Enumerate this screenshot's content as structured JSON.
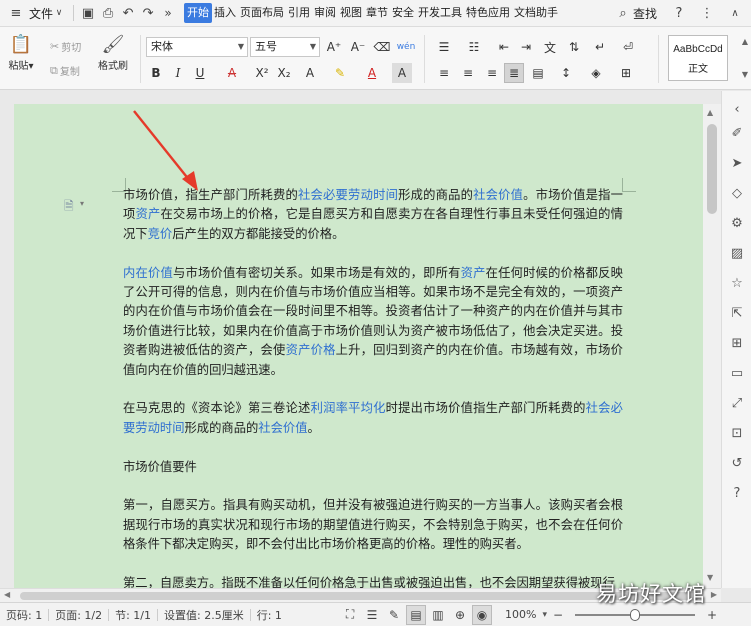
{
  "menubar": {
    "file_label": "文件",
    "tabs": [
      "开始",
      "插入",
      "页面布局",
      "引用",
      "审阅",
      "视图",
      "章节",
      "安全",
      "开发工具",
      "特色应用",
      "文档助手"
    ],
    "active_tab": "开始",
    "search_label": "查找"
  },
  "ribbon": {
    "paste_label": "粘贴",
    "cut_label": "剪切",
    "copy_label": "复制",
    "format_painter_label": "格式刷",
    "font_name": "宋体",
    "font_size": "五号",
    "style_preview": "AaBbCcDd",
    "style_name": "正文"
  },
  "document": {
    "paragraphs": [
      [
        {
          "t": "市场价值，指生产部门所耗费的"
        },
        {
          "t": "社会必要劳动时间",
          "link": true
        },
        {
          "t": "形成的商品的"
        },
        {
          "t": "社会价值",
          "link": true
        },
        {
          "t": "。市场价值是指一项"
        },
        {
          "t": "资产",
          "link": true
        },
        {
          "t": "在交易市场上的价格，它是自愿买方和自愿卖方在各自理性行事且未受任何强迫的情况下"
        },
        {
          "t": "竞价",
          "link": true
        },
        {
          "t": "后产生的双方都能接受的价格。"
        }
      ],
      [
        {
          "t": "内在价值",
          "link": true
        },
        {
          "t": "与市场价值有密切关系。如果市场是有效的，即所有"
        },
        {
          "t": "资产",
          "link": true
        },
        {
          "t": "在任何时候的价格都反映了公开可得的信息，则内在价值与市场价值应当相等。如果市场不是完全有效的，一项资产的内在价值与市场价值会在一段时间里不相等。投资者估计了一种资产的内在价值并与其市场价值进行比较，如果内在价值高于市场价值则认为资产被市场低估了，他会决定买进。投资者购进被低估的资产，会使"
        },
        {
          "t": "资产价格",
          "link": true
        },
        {
          "t": "上升，回归到资产的内在价值。市场越有效，市场价值向内在价值的回归越迅速。"
        }
      ],
      [
        {
          "t": "在马克思的《资本论》第三卷论述"
        },
        {
          "t": "利润率平均化",
          "link": true
        },
        {
          "t": "时提出市场价值指生产部门所耗费的"
        },
        {
          "t": "社会必要劳动时间",
          "link": true
        },
        {
          "t": "形成的商品的"
        },
        {
          "t": "社会价值",
          "link": true
        },
        {
          "t": "。"
        }
      ],
      [
        {
          "t": "市场价值要件"
        }
      ],
      [
        {
          "t": "第一，自愿买方。指具有购买动机，但并没有被强迫进行购买的一方当事人。该购买者会根据现行市场的真实状况和现行市场的期望值进行购买，不会特别急于购买，也不会在任何价格条件下都决定购买，即不会付出比市场价格更高的价格。理性的购买者。"
        }
      ],
      [
        {
          "t": "第二，自愿卖方。指既不准备以任何价格急于出售或被强迫出售，也不会因期望获得被现行"
        }
      ]
    ]
  },
  "statusbar": {
    "page_num": "页码: 1",
    "pages": "页面: 1/2",
    "section": "节: 1/1",
    "setting": "设置值: 2.5厘米",
    "line": "行: 1",
    "zoom": "100%"
  },
  "watermark": "易坊好文馆"
}
